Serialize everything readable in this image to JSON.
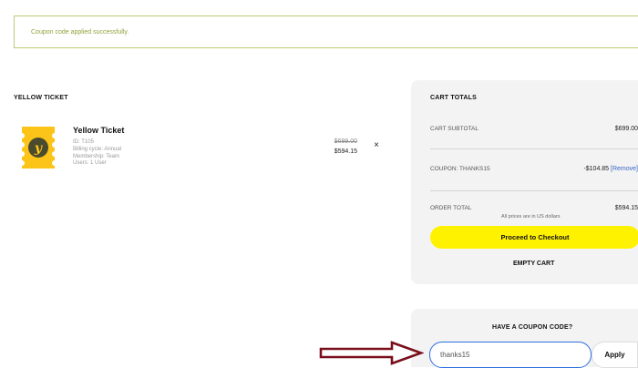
{
  "notice": {
    "text": "Coupon code applied successfully."
  },
  "cart": {
    "section_title": "YELLOW TICKET",
    "item": {
      "title": "Yellow Ticket",
      "meta": [
        "ID: T105",
        "Billing cycle: Annual",
        "Membership: Team",
        "Users: 1 User"
      ],
      "price_original": "$699.00",
      "price_final": "$594.15",
      "remove_symbol": "×"
    }
  },
  "totals": {
    "title": "CART TOTALS",
    "subtotal_label": "CART SUBTOTAL",
    "subtotal_value": "$699.00",
    "coupon_label": "COUPON: THANKS15",
    "coupon_value": "-$104.85",
    "coupon_remove": "[Remove]",
    "order_total_label": "ORDER TOTAL",
    "order_total_value": "$594.15",
    "currency_note": "All prices are in US dollars",
    "checkout_label": "Proceed to Checkout",
    "empty_cart_label": "EMPTY CART"
  },
  "coupon": {
    "title": "HAVE A COUPON CODE?",
    "input_value": "thanks15",
    "apply_label": "Apply"
  },
  "colors": {
    "accent_yellow": "#fff200",
    "notice_green": "#8fa43b",
    "arrow": "#7a0f1c"
  },
  "icons": {
    "ticket": "ticket-logo-icon",
    "close": "close-icon",
    "arrow": "arrow-right-icon"
  }
}
